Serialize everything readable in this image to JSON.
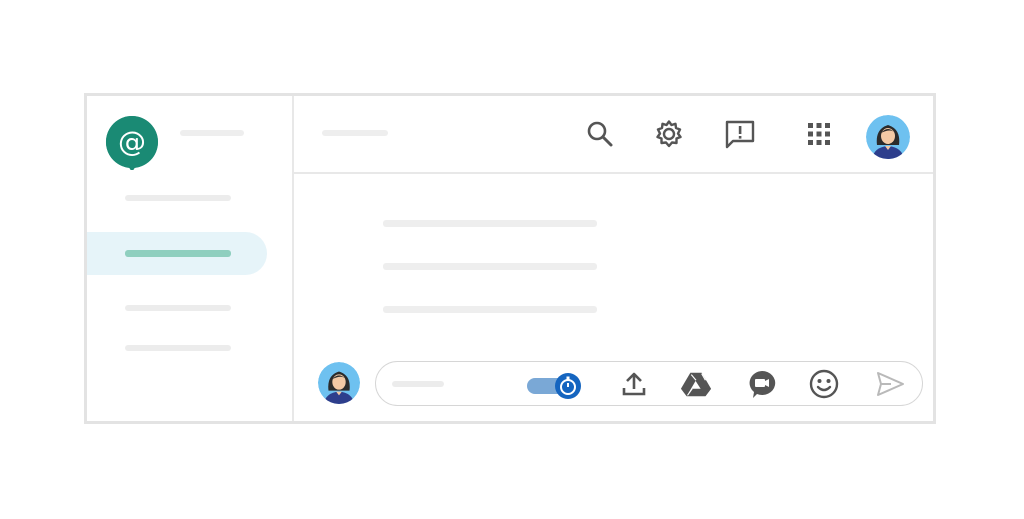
{
  "app": {
    "name": "",
    "brand_color": "#1a8a74"
  },
  "sidebar": {
    "items": [
      {
        "label": "",
        "active": false
      },
      {
        "label": "",
        "active": true
      },
      {
        "label": "",
        "active": false
      },
      {
        "label": "",
        "active": false
      }
    ],
    "active_color": "#e6f4f9",
    "active_bar_color": "#8fcfbf"
  },
  "header": {
    "room_title": "",
    "icons": [
      "search-icon",
      "gear-icon",
      "feedback-icon",
      "apps-grid-icon",
      "avatar"
    ]
  },
  "messages": [
    "",
    "",
    ""
  ],
  "composer": {
    "placeholder": "",
    "history_toggle": {
      "on": true,
      "color": "#1565c0"
    },
    "icons": [
      "history-toggle",
      "upload-icon",
      "drive-icon",
      "meet-icon",
      "emoji-icon",
      "send-icon"
    ]
  }
}
